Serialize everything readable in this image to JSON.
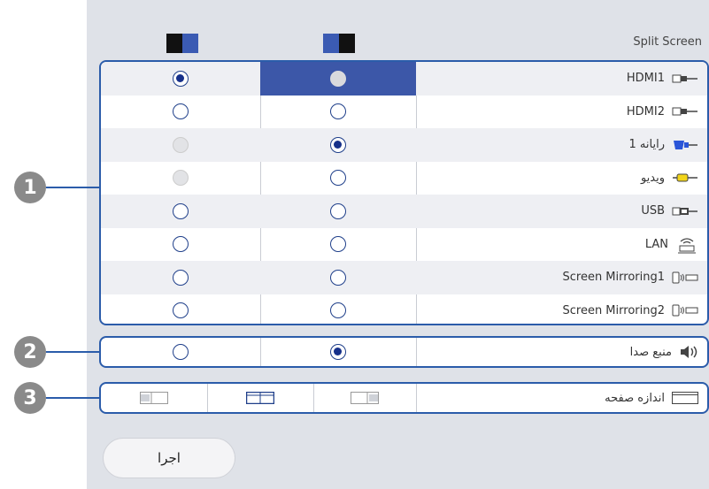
{
  "header": {
    "title": "Split Screen",
    "left_icon": "split-left-icon",
    "right_icon": "split-right-icon"
  },
  "sources": [
    {
      "label": "HDMI1",
      "icon": "hdmi-plug-icon",
      "left": "on",
      "right": "grey",
      "right_selected": true
    },
    {
      "label": "HDMI2",
      "icon": "hdmi-plug-icon",
      "left": "off",
      "right": "off"
    },
    {
      "label": "رایانه 1",
      "icon": "vga-plug-icon",
      "left": "disabled",
      "right": "on"
    },
    {
      "label": "ویدیو",
      "icon": "rca-plug-icon",
      "left": "disabled",
      "right": "off"
    },
    {
      "label": "USB",
      "icon": "usb-plug-icon",
      "left": "off",
      "right": "off"
    },
    {
      "label": "LAN",
      "icon": "lan-wireless-icon",
      "left": "off",
      "right": "off"
    },
    {
      "label": "Screen Mirroring1",
      "icon": "mirroring-icon",
      "left": "off",
      "right": "off"
    },
    {
      "label": "Screen Mirroring2",
      "icon": "mirroring-icon",
      "left": "off",
      "right": "off"
    }
  ],
  "audio": {
    "label": "منبع صدا",
    "icon": "speaker-icon",
    "left": "off",
    "right": "on"
  },
  "screen_size": {
    "label": "اندازه صفحه",
    "icon": "screen-size-icon",
    "options": [
      "left-small",
      "equal",
      "right-small"
    ],
    "selected": 1
  },
  "callouts": [
    "1",
    "2",
    "3"
  ],
  "execute_button": "اجرا",
  "colors": {
    "accent": "#2b5caa",
    "selected_cell": "#3c57a8",
    "radio_on": "#16308a",
    "panel": "#dfe2e8"
  }
}
